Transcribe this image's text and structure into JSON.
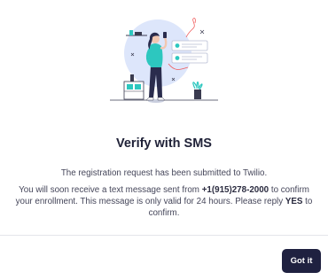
{
  "dialog": {
    "title": "Verify with SMS",
    "message_submitted": "The registration request has been submitted to Twilio.",
    "message_part1": "You will soon receive a text message sent from ",
    "phone_number": "+1(915)278-2000",
    "message_part2": " to confirm your enrollment. This message is only valid for 24 hours. Please reply ",
    "reply_keyword": "YES",
    "message_part3": " to confirm.",
    "confirm_button": "Got it"
  },
  "illustration": {
    "icon": "person-with-phone-notifications-illustration"
  },
  "colors": {
    "button_bg": "#1f2140",
    "button_text": "#ffffff",
    "title": "#1f2137",
    "body_text": "#45465a",
    "illustration_circle": "#dde6fb",
    "accent_teal": "#2dc7bf",
    "accent_red": "#f05a5a"
  }
}
